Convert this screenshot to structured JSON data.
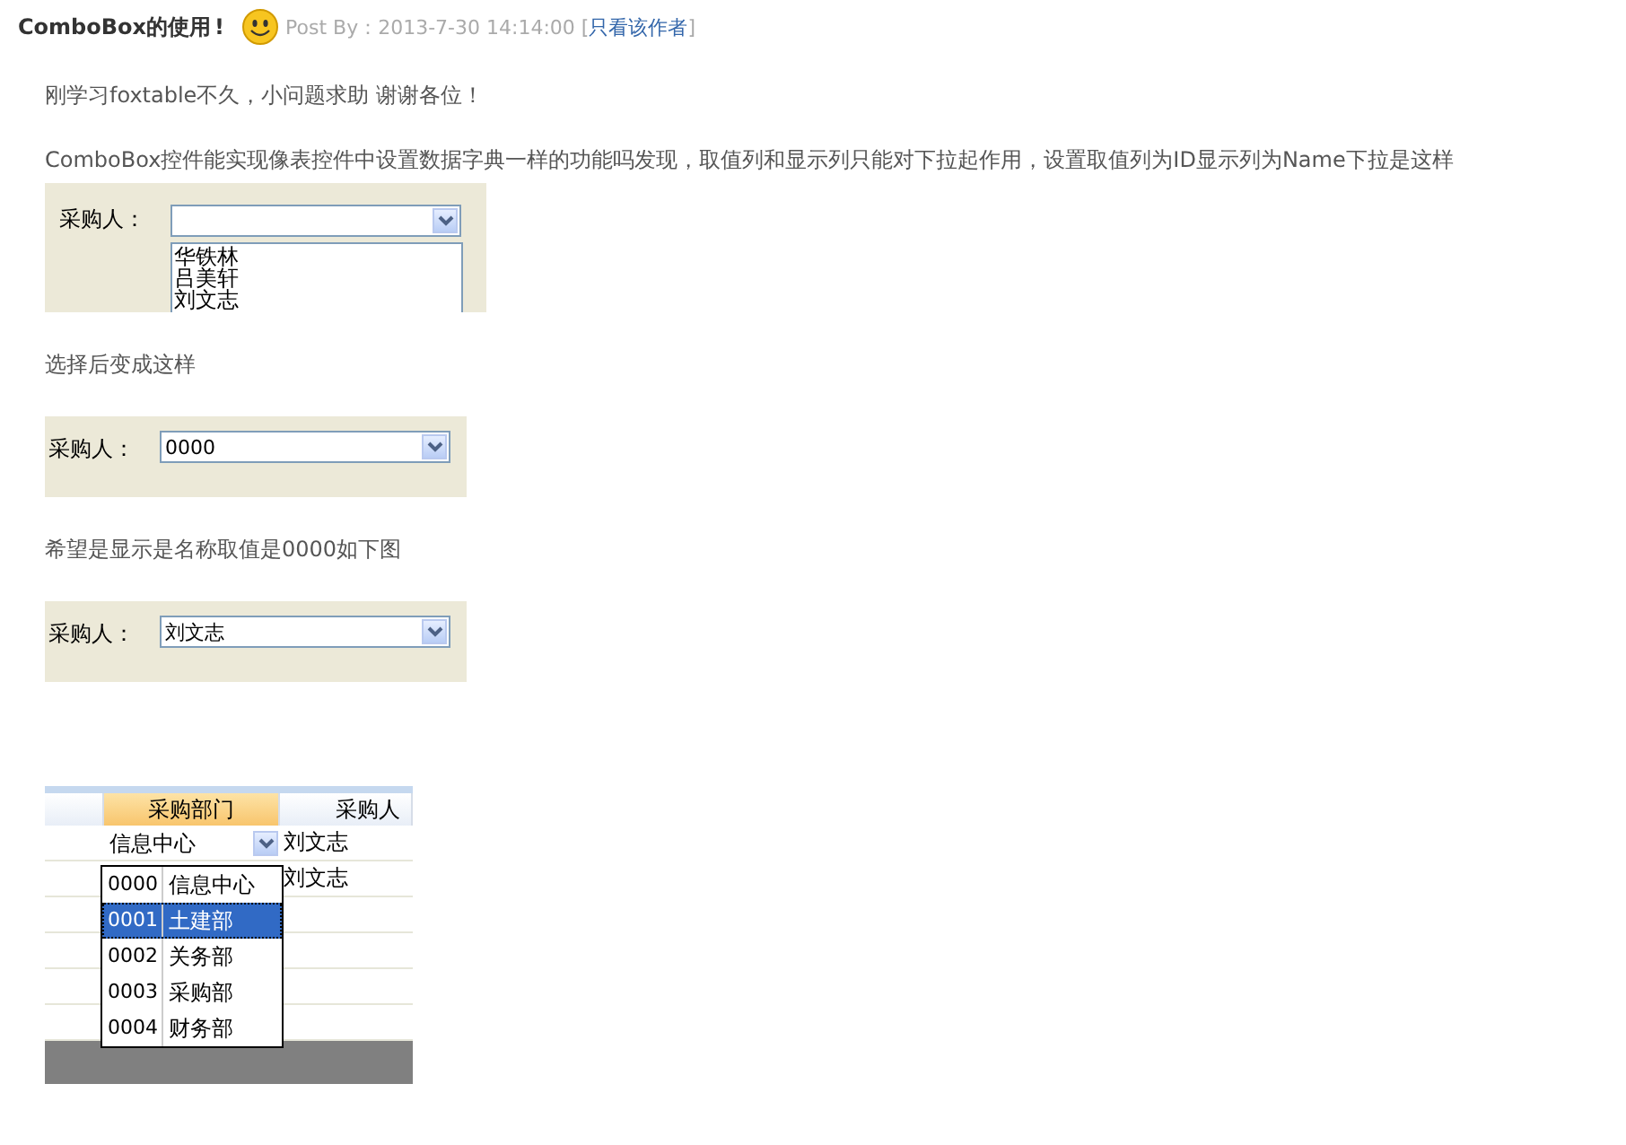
{
  "post": {
    "title": "ComboBox的使用",
    "title_mark": "!",
    "meta": "Post By：2013-7-30 14:14:00 [",
    "author_link": "只看该作者",
    "meta_end": "]"
  },
  "blocks": [
    {
      "kind": "paragraph",
      "text": "刚学习foxtable不久，小问题求助  谢谢各位！"
    },
    {
      "kind": "paragraph",
      "text": " ComboBox控件能实现像表控件中设置数据字典一样的功能吗发现，取值列和显示列只能对下拉起作用，设置取值列为ID显示列为Name下拉是这样"
    },
    {
      "kind": "form_open",
      "label": "采购人：",
      "options": [
        "华铁林",
        "吕美轩",
        "刘文志"
      ]
    },
    {
      "kind": "paragraph",
      "text": "选择后变成这样"
    },
    {
      "kind": "form",
      "label": "采购人：",
      "value": "0000"
    },
    {
      "kind": "paragraph",
      "text": "希望是显示是名称取值是0000如下图"
    },
    {
      "kind": "form",
      "label": "采购人：",
      "value": "刘文志"
    },
    {
      "kind": "grid",
      "columns": [
        {
          "selected": false
        },
        {
          "label": "采购部门",
          "selected": true
        },
        {
          "label": "采购人",
          "selected": false
        }
      ],
      "edit_value": "信息中心",
      "rows": [
        {
          "column_3": "刘文志"
        },
        {
          "column_3": "刘文志"
        },
        {
          "column_3": ""
        },
        {
          "column_3": ""
        },
        {
          "column_3": ""
        },
        {
          "column_3": ""
        }
      ],
      "options": [
        {
          "code": "0000",
          "name": "信息中心",
          "selected": false
        },
        {
          "code": "0001",
          "name": "土建部",
          "selected": true
        },
        {
          "code": "0002",
          "name": "关务部",
          "selected": false
        },
        {
          "code": "0003",
          "name": "采购部",
          "selected": false
        },
        {
          "code": "0004",
          "name": "财务部",
          "selected": false
        }
      ]
    }
  ]
}
